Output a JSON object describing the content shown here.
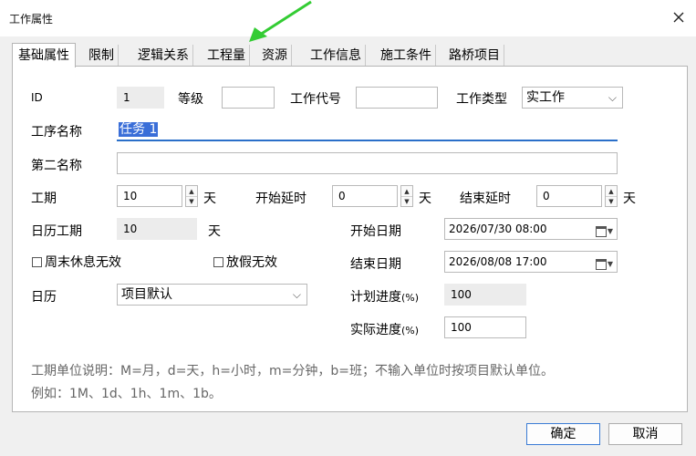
{
  "window": {
    "title": "工作属性"
  },
  "tabs": [
    {
      "label": "基础属性"
    },
    {
      "label": "限制"
    },
    {
      "label": "逻辑关系"
    },
    {
      "label": "工程量"
    },
    {
      "label": "资源"
    },
    {
      "label": "工作信息"
    },
    {
      "label": "施工条件"
    },
    {
      "label": "路桥项目"
    }
  ],
  "form": {
    "id_label": "ID",
    "id_value": "1",
    "grade_label": "等级",
    "grade_value": "",
    "code_label": "工作代号",
    "code_value": "",
    "type_label": "工作类型",
    "type_value": "实工作",
    "name_label": "工序名称",
    "name_value": "任务 1",
    "second_name_label": "第二名称",
    "second_name_value": "",
    "duration_label": "工期",
    "duration_value": "10",
    "duration_unit": "天",
    "start_delay_label": "开始延时",
    "start_delay_value": "0",
    "start_delay_unit": "天",
    "end_delay_label": "结束延时",
    "end_delay_value": "0",
    "end_delay_unit": "天",
    "cal_duration_label": "日历工期",
    "cal_duration_value": "10",
    "cal_duration_unit": "天",
    "start_date_label": "开始日期",
    "start_date_value": "2026/07/30 08:00",
    "end_date_label": "结束日期",
    "end_date_value": "2026/08/08 17:00",
    "weekend_label": "周末休息无效",
    "weekend_checked": false,
    "holiday_label": "放假无效",
    "holiday_checked": false,
    "calendar_label": "日历",
    "calendar_value": "项目默认",
    "plan_progress_label": "计划进度",
    "plan_progress_unit": "(%)",
    "plan_progress_value": "100",
    "actual_progress_label": "实际进度",
    "actual_progress_unit": "(%)",
    "actual_progress_value": "100"
  },
  "notes": {
    "line1": "工期单位说明：M=月，d=天，h=小时，m=分钟，b=班；不输入单位时按项目默认单位。",
    "line2": "例如：1M、1d、1h、1m、1b。"
  },
  "buttons": {
    "ok": "确定",
    "cancel": "取消"
  },
  "colors": {
    "accent": "#3a6ed8",
    "annotation_arrow": "#33cc33"
  }
}
